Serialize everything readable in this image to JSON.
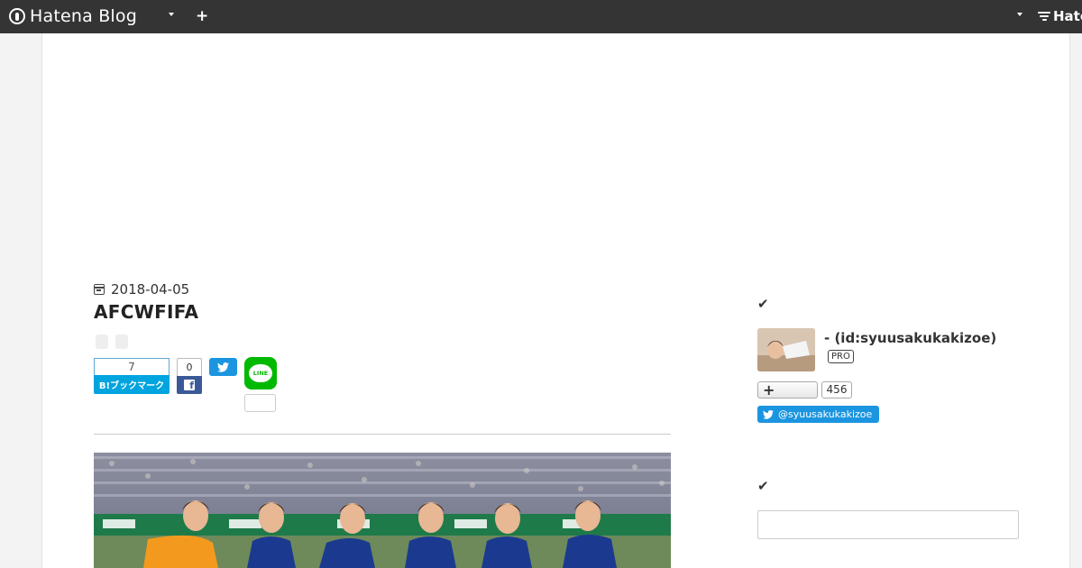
{
  "navbar": {
    "brand": "Hatena Blog",
    "right_brand": "Hatena"
  },
  "article": {
    "date": "2018-04-05",
    "title": "AFCWFIFA",
    "share": {
      "hatena_count": "7",
      "hatena_label": "B!ブックマーク",
      "facebook_count": "0",
      "line_label": "LINE"
    }
  },
  "sidebar": {
    "profile": {
      "name": "-   (id:syuusakukakizoe)",
      "badge": "PRO",
      "reader_count": "456",
      "twitter_handle": "@syuusakukakizoe"
    },
    "search": {
      "placeholder": ""
    }
  },
  "colors": {
    "navbar": "#343434",
    "hatena_blue": "#00a4de",
    "facebook": "#3b5998",
    "twitter": "#1b95e0",
    "line": "#00b900"
  }
}
